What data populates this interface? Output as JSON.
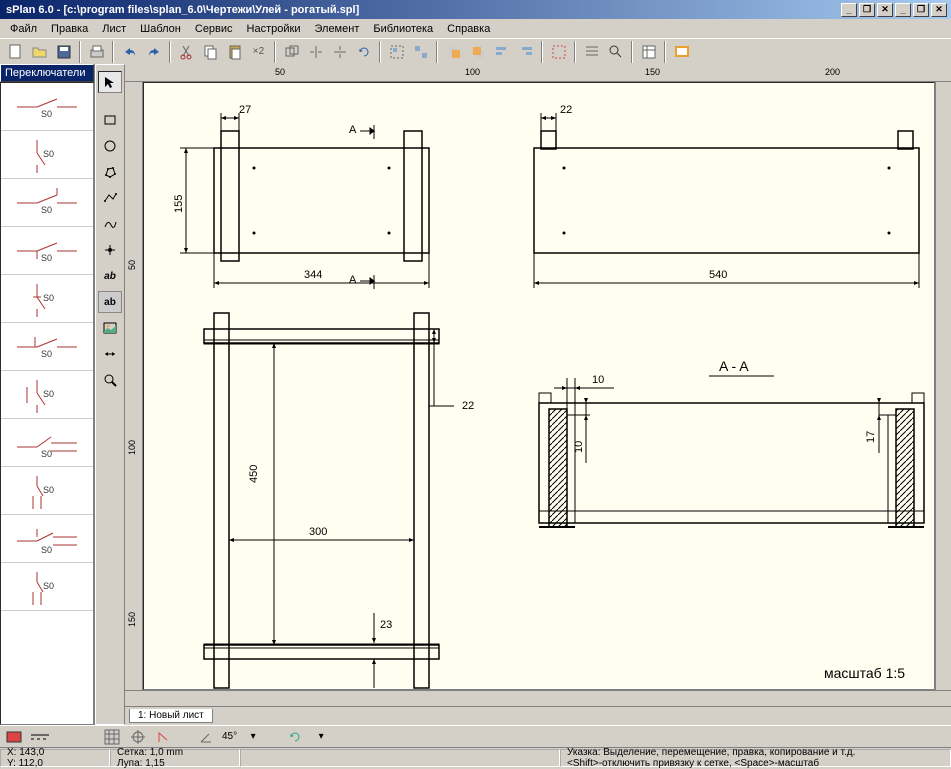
{
  "title": "sPlan 6.0 - [c:\\program files\\splan_6.0\\Чертежи\\Улей - рогатый.spl]",
  "menu": [
    "Файл",
    "Правка",
    "Лист",
    "Шаблон",
    "Сервис",
    "Настройки",
    "Элемент",
    "Библиотека",
    "Справка"
  ],
  "sidebar": {
    "header": "Переключатели",
    "sym_label": "S0"
  },
  "ruler_h": [
    "50",
    "100",
    "150",
    "200"
  ],
  "ruler_v": [
    "50",
    "100",
    "150"
  ],
  "drawing": {
    "dims": {
      "d27": "27",
      "d344": "344",
      "d155": "155",
      "d22a": "22",
      "d540": "540",
      "d22b": "22",
      "d450": "450",
      "d300": "300",
      "d23": "23",
      "d10a": "10",
      "d10b": "10",
      "d17": "17"
    },
    "labels": {
      "A1": "A",
      "A2": "A",
      "section": "A - A",
      "scale": "масштаб  1:5"
    }
  },
  "tab": "1: Новый лист",
  "bottom": {
    "angle": "45°"
  },
  "status": {
    "x": "X: 143,0",
    "y": "Y: 112,0",
    "grid": "Сетка: 1,0 mm",
    "zoom": "Лупа: 1,15",
    "hint1": "Указка: Выделение, перемещение, правка, копирование и т.д.",
    "hint2": "<Shift>-отключить привязку к сетке, <Space>-масштаб"
  },
  "x2": "×2",
  "ab1": "ab",
  "ab2": "ab"
}
